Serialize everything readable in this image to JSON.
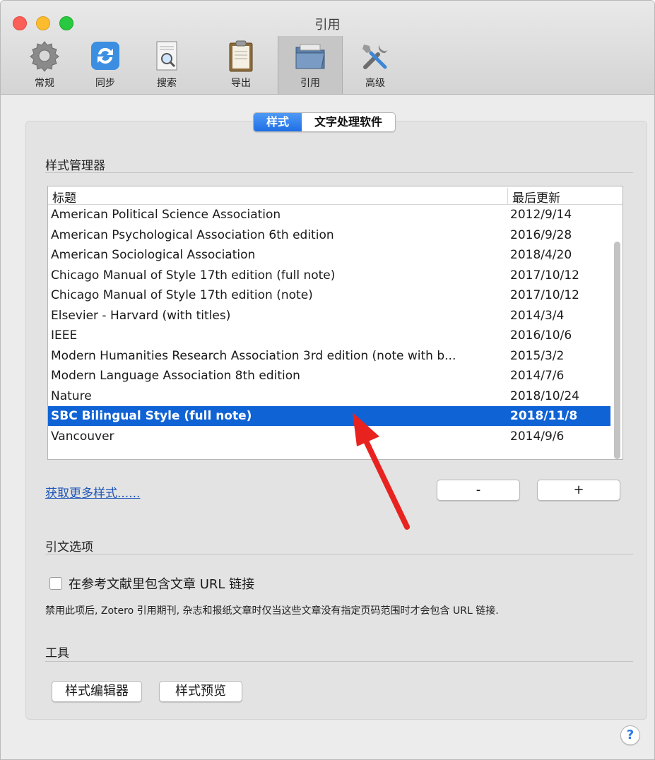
{
  "window": {
    "title": "引用"
  },
  "toolbar": {
    "items": [
      {
        "label": "常规",
        "icon": "gear-icon"
      },
      {
        "label": "同步",
        "icon": "sync-icon"
      },
      {
        "label": "搜索",
        "icon": "search-document-icon"
      },
      {
        "label": "导出",
        "icon": "clipboard-icon"
      },
      {
        "label": "引用",
        "icon": "folder-icon",
        "selected": true
      },
      {
        "label": "高级",
        "icon": "tools-icon"
      }
    ]
  },
  "tabs": {
    "styles": "样式",
    "word_processors": "文字处理软件"
  },
  "style_manager": {
    "title": "样式管理器",
    "columns": {
      "title": "标题",
      "updated": "最后更新"
    },
    "rows": [
      {
        "title": "American Political Science Association",
        "updated": "2012/9/14"
      },
      {
        "title": "American Psychological Association 6th edition",
        "updated": "2016/9/28"
      },
      {
        "title": "American Sociological Association",
        "updated": "2018/4/20"
      },
      {
        "title": "Chicago Manual of Style 17th edition (full note)",
        "updated": "2017/10/12"
      },
      {
        "title": "Chicago Manual of Style 17th edition (note)",
        "updated": "2017/10/12"
      },
      {
        "title": "Elsevier - Harvard (with titles)",
        "updated": "2014/3/4"
      },
      {
        "title": "IEEE",
        "updated": "2016/10/6"
      },
      {
        "title": "Modern Humanities Research Association 3rd edition (note with b...",
        "updated": "2015/3/2"
      },
      {
        "title": "Modern Language Association 8th edition",
        "updated": "2014/7/6"
      },
      {
        "title": "Nature",
        "updated": "2018/10/24"
      },
      {
        "title": "SBC Bilingual Style (full note)",
        "updated": "2018/11/8",
        "selected": true
      },
      {
        "title": "Vancouver",
        "updated": "2014/9/6"
      }
    ],
    "get_more_link": "获取更多样式......",
    "remove_button": "-",
    "add_button": "+"
  },
  "citation_options": {
    "title": "引文选项",
    "include_url_label": "在参考文献里包含文章 URL 链接",
    "include_url_checked": false,
    "hint": "禁用此项后, Zotero 引用期刊, 杂志和报纸文章时仅当这些文章没有指定页码范围时才会包含 URL 链接."
  },
  "tools": {
    "title": "工具",
    "style_editor_button": "样式编辑器",
    "style_preview_button": "样式预览"
  },
  "help_button": "?",
  "colors": {
    "selection": "#0f63d5",
    "segment_active": "#2a7bec",
    "arrow": "#e8231f",
    "link": "#1e56b8"
  }
}
